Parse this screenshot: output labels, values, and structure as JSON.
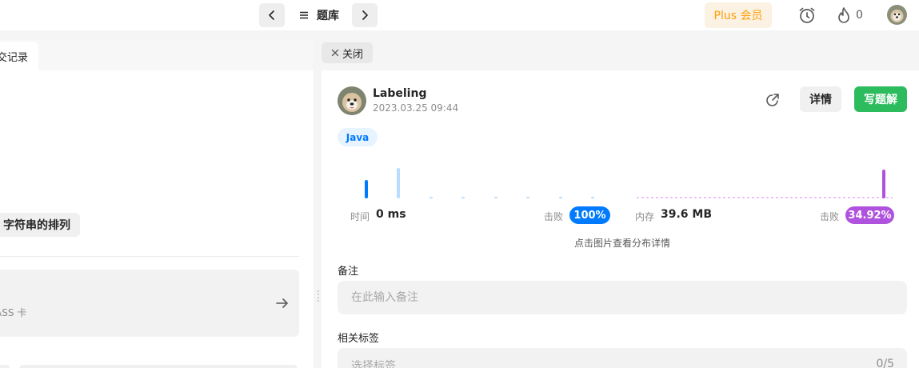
{
  "topbar": {
    "prev_icon": "chevron-left-icon",
    "next_icon": "chevron-right-icon",
    "problem_list_icon": "list-icon",
    "problem_list_label": "题库",
    "plus_label": "Plus 会员",
    "alarm_icon": "alarm-clock-icon",
    "streak_icon": "flame-icon",
    "streak_count": "0",
    "avatar_icon": "user-avatar"
  },
  "left_panel": {
    "tab_label": "交记录",
    "topic_chip": "字符串的排列",
    "pass_card_label": "ASS 卡",
    "pass_arrow_icon": "arrow-right-icon"
  },
  "right_panel": {
    "close_tab_label": "关闭",
    "close_icon": "close-icon",
    "user_name": "Labeling",
    "submit_time": "2023.03.25 09:44",
    "share_icon": "share-icon",
    "details_label": "详情",
    "solution_label": "写题解",
    "language_tag": "Java",
    "runtime": {
      "label": "时间",
      "value": "0 ms",
      "beat_label": "击败",
      "beat_value": "100%",
      "color": "#007aff"
    },
    "memory": {
      "label": "内存",
      "value": "39.6 MB",
      "beat_label": "击败",
      "beat_value": "34.92%",
      "color": "#af52de"
    },
    "chart_hint": "点击图片查看分布详情",
    "notes_label": "备注",
    "notes_placeholder": "在此输入备注",
    "tags_label": "相关标签",
    "tags_placeholder": "选择标签",
    "tags_count": "0/5"
  },
  "colors": {
    "accent_green": "#2cbb5d",
    "plus_orange": "#ff9f0a",
    "runtime_blue": "#007aff",
    "memory_purple": "#af52de"
  }
}
